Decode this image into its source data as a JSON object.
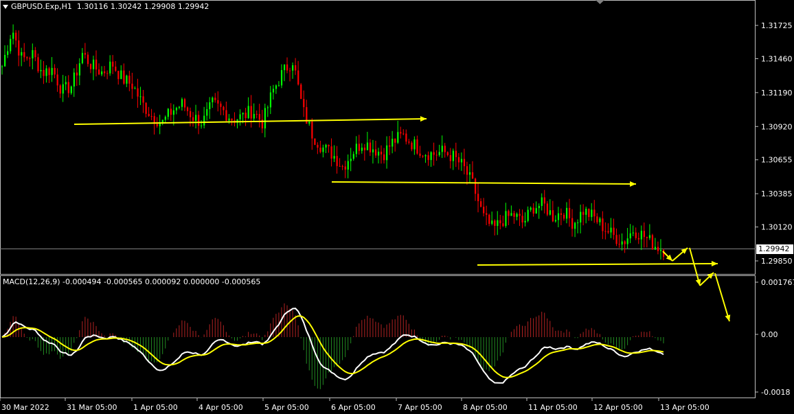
{
  "header": {
    "symbol": "GBPUSD.Exp,H1",
    "ohlc": "1.30116 1.30242 1.29908 1.29942"
  },
  "macd_header": {
    "text": "MACD(12,26,9) -0.000494 -0.000565 0.000092 0.000000 -0.000565"
  },
  "current_price_label": "1.29942",
  "colors": {
    "background": "#000000",
    "bull_candle": "#00ff00",
    "bear_candle": "#ff0000",
    "trendline": "#ffff00",
    "histogram_positive": "#b22222",
    "histogram_negative": "#228b22",
    "macd_line": "#ffffff",
    "signal_line": "#ffff00",
    "grid_border": "#c0c0c0"
  },
  "chart_data": [
    {
      "type": "candlestick",
      "name": "GBPUSD.Exp,H1",
      "y_ticks": [
        "1.31725",
        "1.31460",
        "1.31190",
        "1.30920",
        "1.30655",
        "1.30385",
        "1.30120",
        "1.29850"
      ],
      "ylim": [
        1.2975,
        1.3188
      ],
      "current_price": 1.29942,
      "x_ticks": [
        "30 Mar 2022",
        "31 Mar 05:00",
        "1 Apr 05:00",
        "4 Apr 05:00",
        "5 Apr 05:00",
        "6 Apr 05:00",
        "7 Apr 05:00",
        "8 Apr 05:00",
        "11 Apr 05:00",
        "12 Apr 05:00",
        "13 Apr 05:00"
      ],
      "close_path": [
        1.314,
        1.317,
        1.3145,
        1.315,
        1.3135,
        1.3138,
        1.312,
        1.3125,
        1.315,
        1.314,
        1.3135,
        1.3142,
        1.313,
        1.3125,
        1.311,
        1.31,
        1.3095,
        1.3105,
        1.311,
        1.31,
        1.3095,
        1.311,
        1.3105,
        1.3098,
        1.31,
        1.3105,
        1.3095,
        1.312,
        1.3135,
        1.3145,
        1.3105,
        1.3085,
        1.3075,
        1.307,
        1.306,
        1.3072,
        1.308,
        1.3075,
        1.307,
        1.308,
        1.3085,
        1.3078,
        1.3072,
        1.307,
        1.3072,
        1.3068,
        1.306,
        1.3045,
        1.302,
        1.301,
        1.3018,
        1.3022,
        1.3015,
        1.3028,
        1.303,
        1.302,
        1.3025,
        1.3015,
        1.3025,
        1.302,
        1.3012,
        1.3005,
        1.3,
        1.301,
        1.3005,
        1.2998,
        1.2994
      ]
    },
    {
      "type": "macd",
      "name": "MACD(12,26,9)",
      "parameters": [
        12,
        26,
        9
      ],
      "values": {
        "main": -0.000494,
        "signal": -0.000565,
        "histogram": 9.2e-05,
        "extra1": 0.0,
        "extra2": -0.000565
      },
      "y_ticks": [
        "0.001767",
        "0.00",
        "-0.0018"
      ],
      "ylim": [
        -0.0019,
        0.0019
      ]
    }
  ],
  "annotations": {
    "trendlines": "yellow horizontal arrows and projected zig-zag path"
  }
}
